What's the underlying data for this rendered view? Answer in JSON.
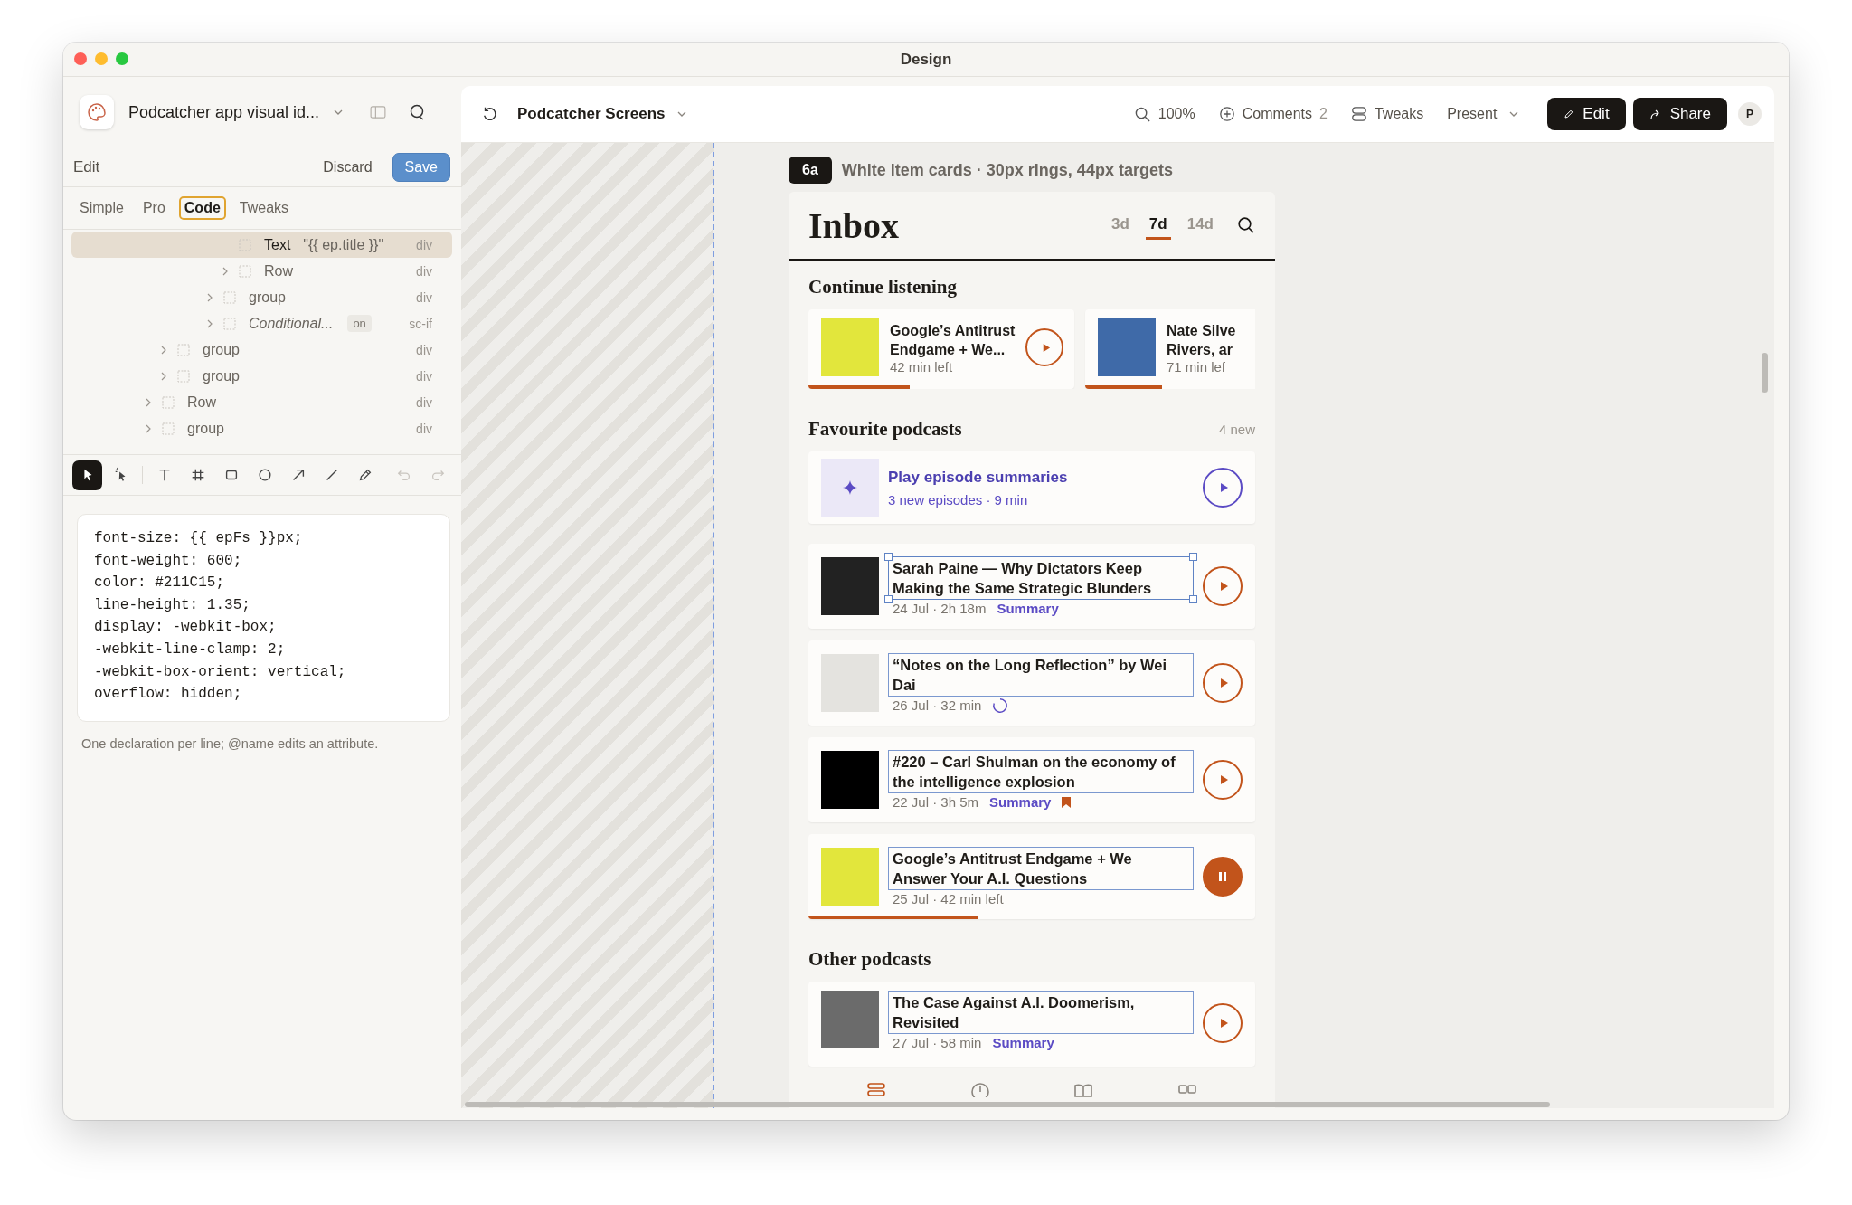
{
  "window": {
    "title": "Design"
  },
  "project": {
    "name": "Podcatcher app visual id..."
  },
  "edit_bar": {
    "title": "Edit",
    "discard": "Discard",
    "save": "Save"
  },
  "mode_tabs": [
    {
      "label": "Simple",
      "selected": false
    },
    {
      "label": "Pro",
      "selected": false
    },
    {
      "label": "Code",
      "selected": true
    },
    {
      "label": "Tweaks",
      "selected": false
    }
  ],
  "layer_tree": [
    {
      "children": [
        {
          "children": [
            {
              "children": [
                {
                  "children": [
                    {
                      "children": [
                        {
                          "label": "Text",
                          "value": "\"{{ ep.title }}\"",
                          "tag": "div",
                          "kind": "leaf",
                          "selected": true
                        },
                        {
                          "label": "Row",
                          "tag": "div",
                          "kind": "branch",
                          "expanded": false,
                          "selected": false
                        }
                      ]
                    },
                    {
                      "label": "group",
                      "tag": "div",
                      "kind": "branch",
                      "expanded": false,
                      "selected": false
                    },
                    {
                      "label": "Conditional...",
                      "badge": "on",
                      "tag": "sc-if",
                      "kind": "condition",
                      "expanded": false,
                      "selected": false
                    }
                  ]
                }
              ]
            }
          ]
        },
        {
          "label": "group",
          "tag": "div",
          "kind": "branch",
          "expanded": false,
          "selected": false
        },
        {
          "label": "group",
          "tag": "div",
          "kind": "branch",
          "expanded": false,
          "selected": false
        }
      ]
    },
    {
      "label": "Row",
      "tag": "div",
      "kind": "branch",
      "expanded": false,
      "selected": false
    },
    {
      "label": "group",
      "tag": "div",
      "kind": "branch",
      "expanded": false,
      "selected": false
    }
  ],
  "tools": [
    {
      "kind": "pointer",
      "selected": true,
      "disabled": false
    },
    {
      "kind": "pick",
      "selected": false,
      "disabled": false
    },
    {
      "kind": "text",
      "selected": false,
      "disabled": false
    },
    {
      "kind": "frame",
      "selected": false,
      "disabled": false
    },
    {
      "kind": "rect",
      "selected": false,
      "disabled": false
    },
    {
      "kind": "ellipse",
      "selected": false,
      "disabled": false
    },
    {
      "kind": "arrow",
      "selected": false,
      "disabled": false
    },
    {
      "kind": "line",
      "selected": false,
      "disabled": false
    },
    {
      "kind": "pencil",
      "selected": false,
      "disabled": false
    },
    {
      "kind": "undo",
      "selected": false,
      "disabled": true
    },
    {
      "kind": "redo",
      "selected": false,
      "disabled": true
    }
  ],
  "code_editor": {
    "lines": [
      "font-size: {{ epFs }}px;",
      "font-weight: 600;",
      "color: #211C15;",
      "line-height: 1.35;",
      "display: -webkit-box;",
      "-webkit-line-clamp: 2;",
      "-webkit-box-orient: vertical;",
      "overflow: hidden;"
    ],
    "hint": "One declaration per line; @name edits an attribute."
  },
  "toolbar": {
    "screen": "Podcatcher Screens",
    "zoom": "100%",
    "comments": "Comments",
    "comment_count": "2",
    "tweaks": "Tweaks",
    "present": "Present",
    "edit": "Edit",
    "share": "Share",
    "avatar": "P"
  },
  "canvas": {
    "frame_tag": "6a",
    "frame_caption": "White item cards · 30px rings, 44px targets"
  },
  "app": {
    "title": "Inbox",
    "ranges": [
      {
        "label": "3d",
        "selected": false
      },
      {
        "label": "7d",
        "selected": true
      },
      {
        "label": "14d",
        "selected": false
      }
    ],
    "continue": {
      "heading": "Continue listening",
      "items": [
        {
          "title_lines": [
            "Google’s Antitrust",
            "Endgame + We..."
          ],
          "meta": "42 min left",
          "level": 0.38,
          "color": "#e2e63c"
        },
        {
          "title_lines": [
            "Nate Silve",
            "Rivers, ar"
          ],
          "meta": "71 min lef",
          "level": 0.45,
          "color": "#3f6aa8"
        }
      ]
    },
    "favourites": {
      "heading": "Favourite podcasts",
      "badge": "4 new",
      "summary": {
        "title": "Play episode summaries",
        "subtitle": "3 new episodes · 9 min"
      },
      "episodes": [
        {
          "title": "Sarah Paine — Why Dictators Keep Making the Same Strategic Blunders",
          "meta": "24 Jul · 2h 18m",
          "link": "Summary",
          "selected": true,
          "loading": false,
          "bookmarked": false,
          "playing": false,
          "color": "#222222"
        },
        {
          "title": "“Notes on the Long Reflection” by Wei Dai",
          "meta": "26 Jul · 32 min",
          "selected": false,
          "loading": true,
          "bookmarked": false,
          "playing": false,
          "color": "#e4e3df"
        },
        {
          "title": "#220 – Carl Shulman on the economy of the intelligence explosion",
          "meta": "22 Jul · 3h 5m",
          "link": "Summary",
          "selected": false,
          "loading": false,
          "bookmarked": true,
          "playing": false,
          "color": "#000000"
        },
        {
          "title": "Google’s Antitrust Endgame + We Answer Your A.I. Questions",
          "meta": "25 Jul · 42 min left",
          "selected": false,
          "loading": false,
          "bookmarked": false,
          "playing": true,
          "level": 0.38,
          "color": "#e2e63c"
        }
      ]
    },
    "other": {
      "heading": "Other podcasts",
      "episodes": [
        {
          "title": "The Case Against A.I. Doomerism, Revisited",
          "meta": "27 Jul · 58 min",
          "link": "Summary",
          "selected": false,
          "loading": false,
          "bookmarked": false,
          "playing": false,
          "color": "#6b6b6b"
        }
      ]
    },
    "tab_bar": [
      {
        "kind": "list",
        "selected": true
      },
      {
        "kind": "clock",
        "selected": false
      },
      {
        "kind": "book",
        "selected": false
      },
      {
        "kind": "grid",
        "selected": false
      }
    ]
  }
}
